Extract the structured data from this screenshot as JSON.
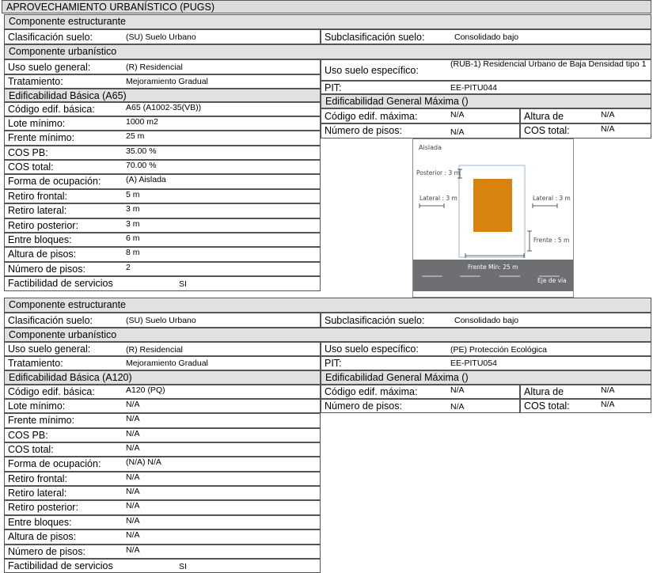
{
  "title": "APROVECHAMIENTO URBANÍSTICO (PUGS)",
  "sections": [
    {
      "estructurante": {
        "header": "Componente  estructurante",
        "clasif_label": "Clasificación suelo:",
        "clasif_value": "(SU) Suelo Urbano",
        "subclasif_label": "Subclasificación suelo:",
        "subclasif_value": "Consolidado bajo"
      },
      "urbanistico": {
        "header": "Componente  urbanístico",
        "uso_general_label": "Uso suelo general:",
        "uso_general_value": "(R) Residencial",
        "uso_especifico_label": "Uso suelo específico:",
        "uso_especifico_value": "(RUB-1) Residencial Urbano de Baja Densidad tipo 1",
        "tratamiento_label": "Tratamiento:",
        "tratamiento_value": "Mejoramiento Gradual",
        "pit_label": "PIT:",
        "pit_value": "EE-PITU044"
      },
      "basica": {
        "header": "Edificabilidad Básica (A65)",
        "rows": [
          {
            "label": "Código edif. básica:",
            "value": "A65 (A1002-35(VB))"
          },
          {
            "label": "Lote mínimo:",
            "value": "1000 m2"
          },
          {
            "label": "Frente mínimo:",
            "value": "25 m"
          },
          {
            "label": "COS PB:",
            "value": "35.00 %"
          },
          {
            "label": "COS total:",
            "value": "70.00 %"
          },
          {
            "label": "Forma de ocupación:",
            "value": "(A) Aislada"
          },
          {
            "label": "Retiro frontal:",
            "value": "5 m"
          },
          {
            "label": "Retiro lateral:",
            "value": "3 m"
          },
          {
            "label": "Retiro posterior:",
            "value": "3 m"
          },
          {
            "label": "Entre bloques:",
            "value": "6 m"
          },
          {
            "label": "Altura de pisos:",
            "value": "8 m"
          },
          {
            "label": "Número de pisos:",
            "value": "2"
          },
          {
            "label": "Factibilidad de servicios",
            "value": "SI"
          }
        ]
      },
      "maxima": {
        "header": "Edificabilidad General Máxima ()",
        "codigo_label": "Código edif. máxima:",
        "codigo_value": "N/A",
        "altura_label": "Altura de",
        "altura_value": "N/A",
        "pisos_label": "Número de pisos:",
        "pisos_value": "N/A",
        "cos_label": "COS total:",
        "cos_value": "N/A"
      }
    },
    {
      "estructurante": {
        "header": "Componente  estructurante",
        "clasif_label": "Clasificación suelo:",
        "clasif_value": "(SU) Suelo Urbano",
        "subclasif_label": "Subclasificación suelo:",
        "subclasif_value": "Consolidado bajo"
      },
      "urbanistico": {
        "header": "Componente  urbanístico",
        "uso_general_label": "Uso suelo general:",
        "uso_general_value": "(R) Residencial",
        "uso_especifico_label": "Uso suelo específico:",
        "uso_especifico_value": "(PE) Protección Ecológica",
        "tratamiento_label": "Tratamiento:",
        "tratamiento_value": "Mejoramiento Gradual",
        "pit_label": "PIT:",
        "pit_value": "EE-PITU054"
      },
      "basica": {
        "header": "Edificabilidad Básica (A120)",
        "rows": [
          {
            "label": "Código edif. básica:",
            "value": "A120 (PQ)"
          },
          {
            "label": "Lote mínimo:",
            "value": "N/A"
          },
          {
            "label": "Frente mínimo:",
            "value": "N/A"
          },
          {
            "label": "COS PB:",
            "value": "N/A"
          },
          {
            "label": "COS total:",
            "value": "N/A"
          },
          {
            "label": "Forma de ocupación:",
            "value": "(N/A) N/A"
          },
          {
            "label": "Retiro frontal:",
            "value": "N/A"
          },
          {
            "label": "Retiro lateral:",
            "value": "N/A"
          },
          {
            "label": "Retiro posterior:",
            "value": "N/A"
          },
          {
            "label": "Entre bloques:",
            "value": "N/A"
          },
          {
            "label": "Altura de pisos:",
            "value": "N/A"
          },
          {
            "label": "Número de pisos:",
            "value": "N/A"
          },
          {
            "label": "Factibilidad de servicios",
            "value": "SI"
          }
        ]
      },
      "maxima": {
        "header": "Edificabilidad General Máxima ()",
        "codigo_label": "Código edif. máxima:",
        "codigo_value": "N/A",
        "altura_label": "Altura de",
        "altura_value": "N/A",
        "pisos_label": "Número de pisos:",
        "pisos_value": "N/A",
        "cos_label": "COS total:",
        "cos_value": "N/A"
      }
    }
  ],
  "diagram": {
    "type_label": "Aislada",
    "posterior_label": "Posterior : 3 m",
    "lateral_left_label": "Lateral : 3 m",
    "lateral_right_label": "Lateral : 3 m",
    "frente_label": "Frente : 5 m",
    "frente_min_label": "Frente Mín: 25 m",
    "eje_via_label": "Eje de vía",
    "building_color": "#d9830f",
    "road_color": "#6d6f72"
  }
}
